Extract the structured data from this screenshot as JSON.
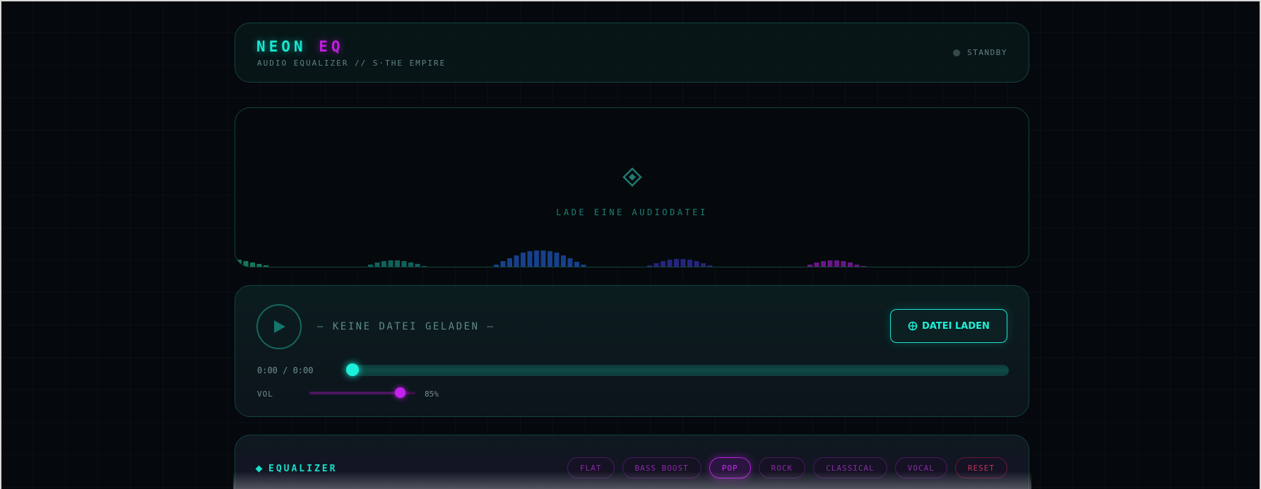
{
  "header": {
    "logo_primary": "NEON",
    "logo_accent": "EQ",
    "subtitle": "AUDIO EQUALIZER // S·THE EMPIRE",
    "status": "STANDBY"
  },
  "visualizer": {
    "hint": "LADE EINE AUDIODATEI",
    "icon": "diamond-icon",
    "idle_bars": [
      {
        "color": "#168a6a",
        "heights": [
          12,
          10,
          8,
          6,
          4
        ]
      },
      {
        "color": "#12726a",
        "heights": [
          5,
          8,
          10,
          11,
          11,
          10,
          8,
          6,
          3
        ]
      },
      {
        "color": "#1a4aa0",
        "heights": [
          5,
          10,
          14,
          18,
          22,
          24,
          25,
          25,
          24,
          22,
          18,
          14,
          9,
          5,
          2
        ]
      },
      {
        "color": "#2a2a90",
        "heights": [
          4,
          7,
          10,
          12,
          13,
          13,
          12,
          10,
          7,
          4
        ]
      },
      {
        "color": "#7a1a9a",
        "heights": [
          5,
          8,
          10,
          11,
          11,
          10,
          8,
          5,
          3
        ]
      }
    ]
  },
  "player": {
    "track": "— KEINE DATEI GELADEN —",
    "load_button": "DATEI LADEN",
    "time": "0:00 / 0:00",
    "progress": 0,
    "volume_label": "VOL",
    "volume_value": "85%",
    "volume": 0.85
  },
  "equalizer": {
    "title": "EQUALIZER",
    "presets": [
      {
        "label": "FLAT",
        "active": false
      },
      {
        "label": "BASS BOOST",
        "active": false
      },
      {
        "label": "POP",
        "active": true
      },
      {
        "label": "ROCK",
        "active": false
      },
      {
        "label": "CLASSICAL",
        "active": false
      },
      {
        "label": "VOCAL",
        "active": false
      }
    ],
    "reset_label": "RESET"
  },
  "colors": {
    "cyan": "#16e8d2",
    "magenta": "#c21ee0",
    "reset": "#c0345a"
  }
}
